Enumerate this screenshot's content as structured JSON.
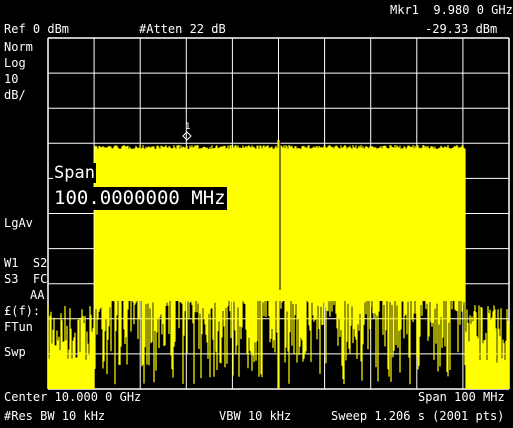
{
  "header": {
    "marker": "Mkr1  9.980 0 GHz",
    "ref_level": "Ref 0 dBm",
    "attenuation": "#Atten 22 dB",
    "marker_level": "-29.33 dBm"
  },
  "left_panel": {
    "det_mode": "Norm",
    "scale_type": "Log",
    "scale_value": "10",
    "scale_unit": "dB/",
    "average": "LgAv",
    "trace_line1": "W1  S2",
    "trace_line2": "S3  FC",
    "trace_line3": "AA",
    "freq_func": "£(f):",
    "freq_tune": "FTun",
    "sweep": "Swp"
  },
  "marker_label": "1",
  "active_entry": {
    "title": "Span",
    "value": "100.0000000 MHz"
  },
  "footer": {
    "center": "Center 10.000 0 GHz",
    "span": "Span 100 MHz",
    "res_bw": "#Res BW 10 kHz",
    "vbw": "VBW 10 kHz",
    "sweep_time": "Sweep 1.206 s (2001 pts)"
  },
  "colors": {
    "trace": "#ffff00",
    "grid": "#ffffff",
    "background": "#000000"
  }
}
